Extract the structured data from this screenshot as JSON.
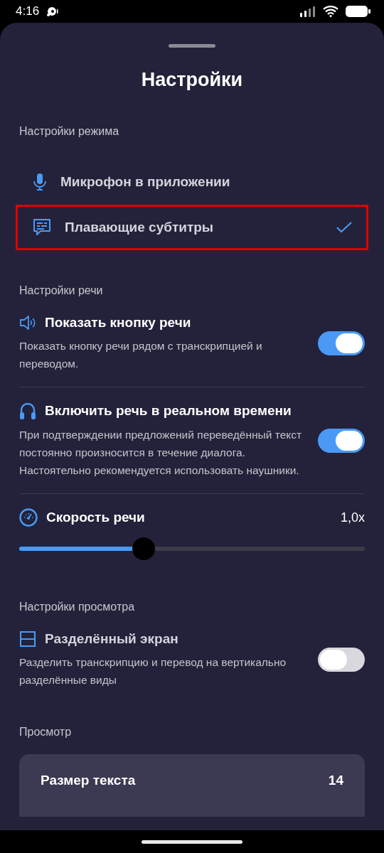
{
  "status_bar": {
    "time": "4:16"
  },
  "title": "Настройки",
  "mode_section": {
    "heading": "Настройки режима",
    "items": [
      {
        "kind": "mic",
        "label": "Микрофон в приложении",
        "selected": false
      },
      {
        "kind": "subtitles",
        "label": "Плавающие субтитры",
        "selected": true
      }
    ]
  },
  "speech_section": {
    "heading": "Настройки речи",
    "rows": [
      {
        "kind": "toggle",
        "title": "Показать кнопку речи",
        "description": "Показать кнопку речи рядом с транскрипцией и переводом.",
        "on": true
      },
      {
        "kind": "toggle",
        "title": "Включить речь в реальном времени",
        "description": "При подтверждении предложений переведённый текст постоянно произносится в течение диалога. Настоятельно рекомендуется использовать наушники.",
        "on": true
      },
      {
        "kind": "slider",
        "title": "Скорость речи",
        "reading": "1,0x",
        "level": 0.36
      }
    ]
  },
  "view_section": {
    "heading": "Настройки просмотра",
    "rows": [
      {
        "kind": "toggle",
        "title": "Разделённый экран",
        "description": "Разделить транскрипцию и перевод на вертикально разделённые виды",
        "on": false
      }
    ]
  },
  "display_section": {
    "heading": "Просмотр",
    "card": {
      "label": "Размер текста",
      "value": "14"
    }
  }
}
